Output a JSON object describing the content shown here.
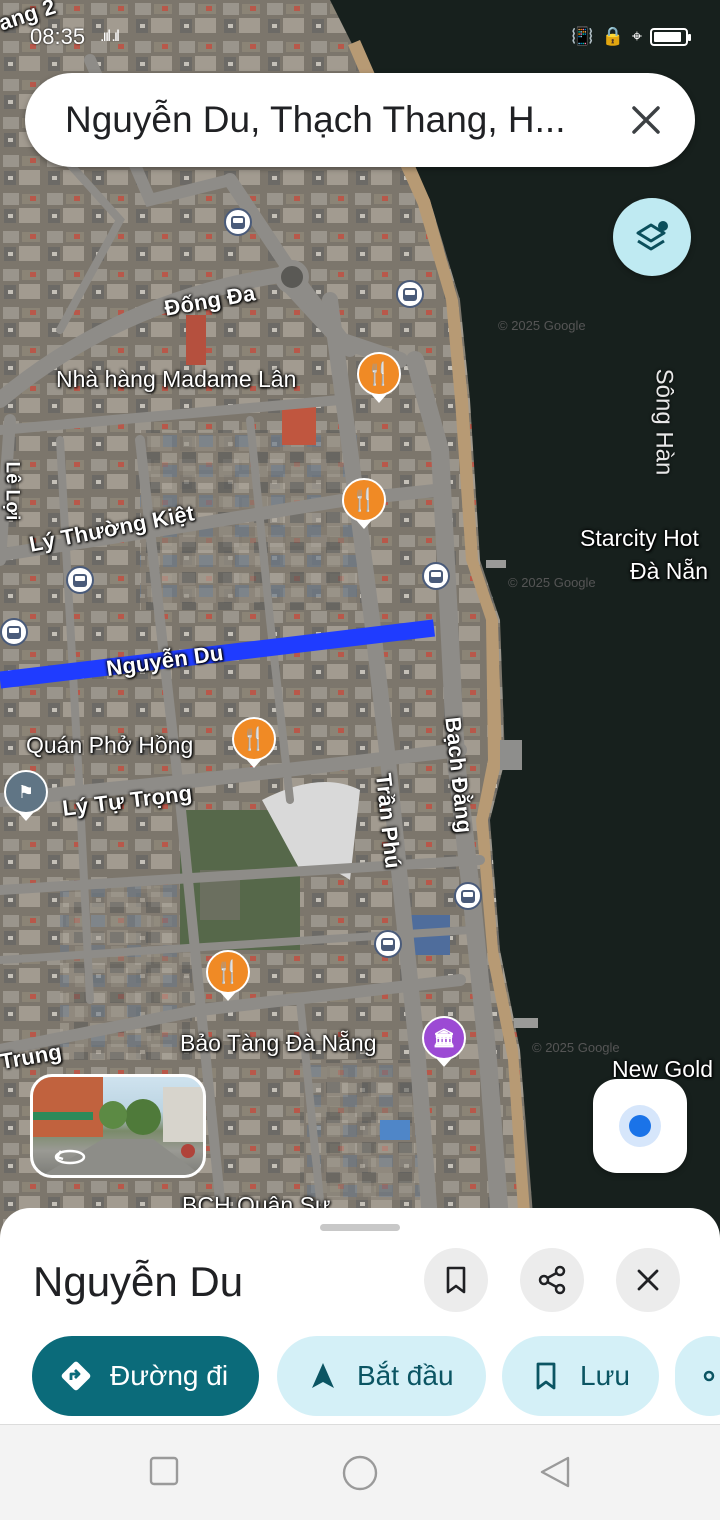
{
  "status_bar": {
    "time": "08:35",
    "battery_level": 0.9
  },
  "search": {
    "query": "Nguyễn Du, Thạch Thang, H..."
  },
  "map": {
    "road_labels": [
      "Đống Đa",
      "Lý Thường Kiệt",
      "Nguyễn Du",
      "Lý Tự Trọng",
      "Trần Phú",
      "Bạch Đằng",
      "Trung"
    ],
    "partial_road_labels": [
      "ang 2",
      "Lê Lợi"
    ],
    "poi_labels": [
      "Nhà hàng Madame Lân",
      "Quán Phở Hồng",
      "Bảo Tàng Đà Nẵng",
      "BCH Quân Sự"
    ],
    "river_label": "Sông Hàn",
    "hotel_label_line1": "Starcity Hot",
    "hotel_label_line2": "Đà Nẵn",
    "other_label": "New Gold",
    "watermarks": [
      "© 2025 Google",
      "© 2025 Google",
      "© 2025 Google"
    ],
    "highlight_color": "#1f3cff",
    "food_pin_color": "#f08a25",
    "museum_pin_color": "#9c4ad4"
  },
  "sheet": {
    "title": "Nguyễn Du",
    "chips": {
      "directions": "Đường đi",
      "start": "Bắt đầu",
      "save": "Lưu"
    }
  },
  "colors": {
    "primary_chip": "#0b6b7a",
    "secondary_chip": "#d4f0f7",
    "layers_button": "#bfeaf2"
  }
}
